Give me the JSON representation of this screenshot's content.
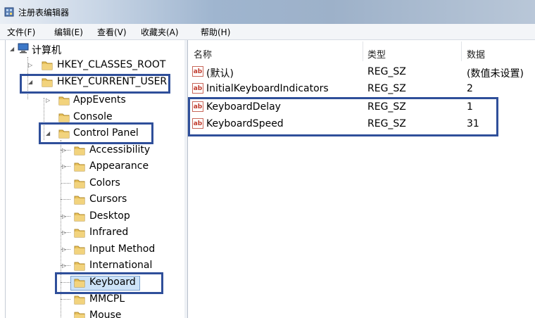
{
  "window": {
    "title": "注册表编辑器"
  },
  "menu": [
    "文件(F)",
    "编辑(E)",
    "查看(V)",
    "收藏夹(A)",
    "帮助(H)"
  ],
  "tree": {
    "root": "计算机",
    "hkcr": "HKEY_CLASSES_ROOT",
    "hkcu": "HKEY_CURRENT_USER",
    "appevents": "AppEvents",
    "console": "Console",
    "control_panel": "Control Panel",
    "accessibility": "Accessibility",
    "appearance": "Appearance",
    "colors": "Colors",
    "cursors": "Cursors",
    "desktop": "Desktop",
    "infrared": "Infrared",
    "input_method": "Input Method",
    "international": "International",
    "keyboard": "Keyboard",
    "mmcpl": "MMCPL",
    "mouse": "Mouse"
  },
  "columns": {
    "name": "名称",
    "type": "类型",
    "data": "数据"
  },
  "values": [
    {
      "name": "(默认)",
      "type": "REG_SZ",
      "data": "(数值未设置)"
    },
    {
      "name": "InitialKeyboardIndicators",
      "type": "REG_SZ",
      "data": "2"
    },
    {
      "name": "KeyboardDelay",
      "type": "REG_SZ",
      "data": "1"
    },
    {
      "name": "KeyboardSpeed",
      "type": "REG_SZ",
      "data": "31"
    }
  ],
  "icons": {
    "value": "string-value-icon",
    "folder": "folder-icon"
  },
  "colors": {
    "highlight_border": "#2f4f9a",
    "folder": "#e8c15a"
  }
}
